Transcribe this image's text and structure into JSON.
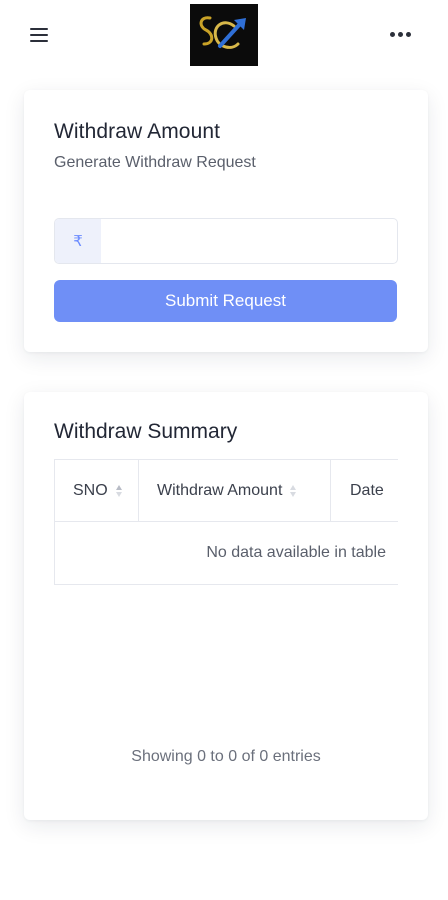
{
  "header": {
    "menu_icon": "hamburger-menu-icon",
    "logo_icon": "sc-brand-logo",
    "more_icon": "more-dots-icon"
  },
  "withdraw_form": {
    "title": "Withdraw Amount",
    "subtitle": "Generate Withdraw Request",
    "currency_symbol": "₹",
    "amount_value": "",
    "amount_placeholder": "",
    "submit_label": "Submit Request"
  },
  "summary": {
    "title": "Withdraw Summary",
    "columns": [
      "SNO",
      "Withdraw Amount",
      "Date"
    ],
    "empty_message": "No data available in table",
    "info_text": "Showing 0 to 0 of 0 entries"
  },
  "colors": {
    "accent": "#6f8ff6",
    "prefix_bg": "#eef1fb",
    "page_bg": "#ffffff"
  }
}
